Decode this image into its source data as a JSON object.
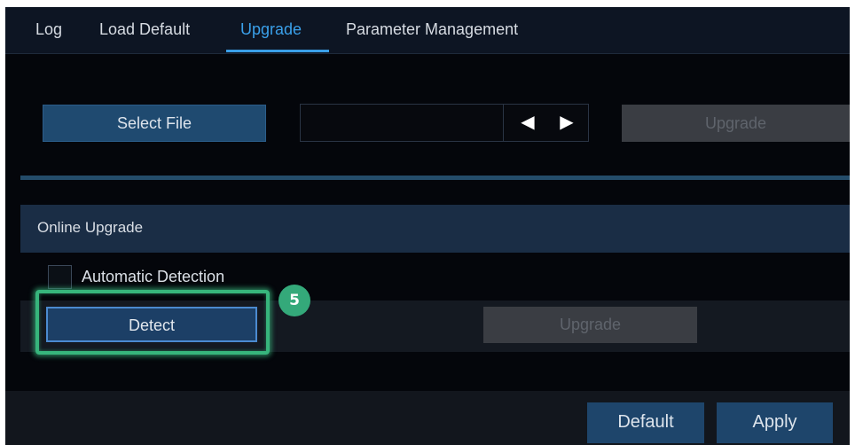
{
  "tabs": [
    {
      "label": "Log",
      "active": false
    },
    {
      "label": "Load Default",
      "active": false
    },
    {
      "label": "Upgrade",
      "active": true
    },
    {
      "label": "Parameter Management",
      "active": false
    }
  ],
  "local_upgrade": {
    "select_file_label": "Select File",
    "file_name": "",
    "prev_icon": "triangle-left-icon",
    "next_icon": "triangle-right-icon",
    "upgrade_label": "Upgrade",
    "upgrade_enabled": false
  },
  "online_upgrade": {
    "section_title": "Online Upgrade",
    "automatic_detection_label": "Automatic Detection",
    "automatic_detection_checked": false,
    "detect_label": "Detect",
    "upgrade_label": "Upgrade",
    "upgrade_enabled": false
  },
  "annotation": {
    "step_number": "5",
    "highlight_color": "#37b57c"
  },
  "footer": {
    "default_label": "Default",
    "apply_label": "Apply"
  },
  "colors": {
    "accent": "#3aa0ea",
    "button_primary": "#1f4a70",
    "button_disabled": "#3a3d43",
    "background": "#04060b"
  }
}
